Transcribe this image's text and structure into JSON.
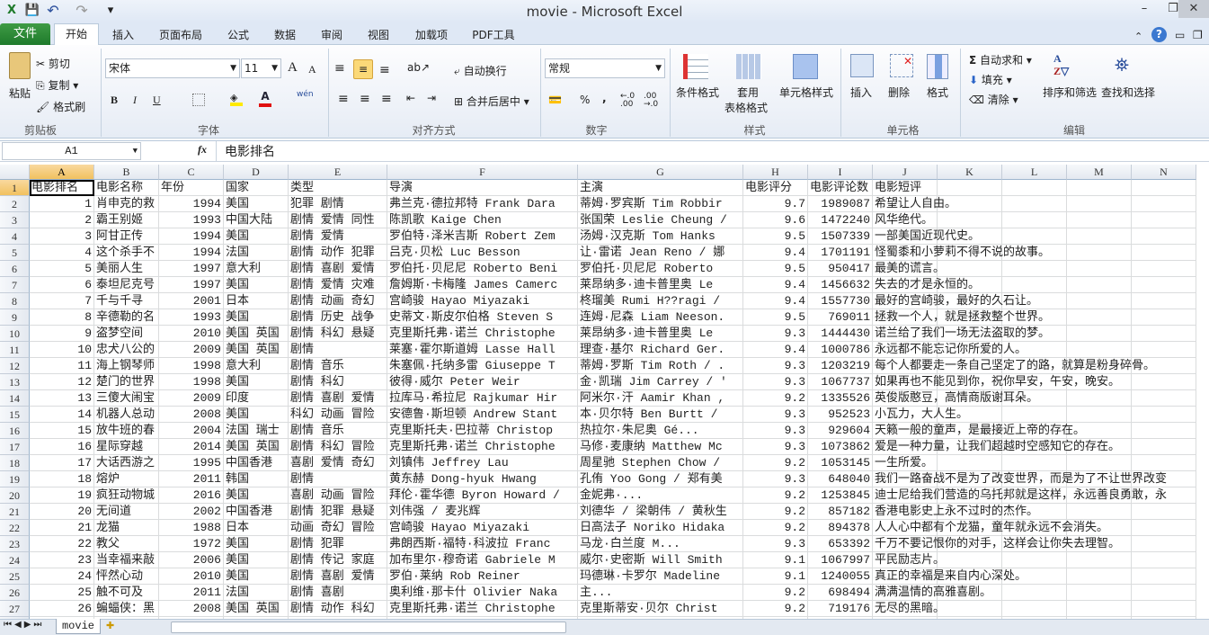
{
  "window": {
    "title": "movie - Microsoft Excel",
    "minimize": "–",
    "restore": "❐",
    "close": "✕"
  },
  "quick_access": {
    "save": "💾",
    "undo": "↶",
    "redo": "↷",
    "customize": "▾"
  },
  "tabs": [
    "文件",
    "开始",
    "插入",
    "页面布局",
    "公式",
    "数据",
    "审阅",
    "视图",
    "加载项",
    "PDF工具"
  ],
  "ribbon": {
    "clipboard": {
      "label": "剪贴板",
      "paste": "粘贴",
      "cut": "剪切",
      "copy": "复制",
      "format_painter": "格式刷"
    },
    "font": {
      "label": "字体",
      "font_name": "宋体",
      "font_size": "11",
      "bold": "B",
      "italic": "I",
      "underline": "U",
      "grow": "A",
      "shrink": "A",
      "phonetic": "wén"
    },
    "alignment": {
      "label": "对齐方式",
      "wrap": "自动换行",
      "merge": "合并后居中"
    },
    "number": {
      "label": "数字",
      "format": "常规",
      "percent": "%",
      "comma": ","
    },
    "styles": {
      "label": "样式",
      "conditional": "条件格式",
      "table_format_1": "套用",
      "table_format_2": "表格格式",
      "cell_styles": "单元格样式"
    },
    "cells": {
      "label": "单元格",
      "insert": "插入",
      "delete": "删除",
      "format": "格式"
    },
    "editing": {
      "label": "编辑",
      "autosum": "自动求和",
      "fill": "填充",
      "clear": "清除",
      "sort_filter": "排序和筛选",
      "find_select": "查找和选择"
    }
  },
  "formula_bar": {
    "name_box": "A1",
    "fx": "fx",
    "value": "电影排名"
  },
  "columns": [
    "A",
    "B",
    "C",
    "D",
    "E",
    "F",
    "G",
    "H",
    "I",
    "J",
    "K",
    "L",
    "M",
    "N"
  ],
  "header_row": [
    "电影排名",
    "电影名称",
    "年份",
    "国家",
    "类型",
    "导演",
    "主演",
    "电影评分",
    "电影评论数",
    "电影短评"
  ],
  "rows": [
    [
      "1",
      "肖申克的救",
      "1994",
      "美国",
      "犯罪 剧情",
      "弗兰克·德拉邦特 Frank Dara",
      "蒂姆·罗宾斯 Tim Robbir",
      "9.7",
      "1989087",
      "希望让人自由。"
    ],
    [
      "2",
      "霸王别姬",
      "1993",
      "中国大陆",
      "剧情 爱情 同性",
      "陈凯歌 Kaige Chen",
      "张国荣 Leslie Cheung /",
      "9.6",
      "1472240",
      "风华绝代。"
    ],
    [
      "3",
      "阿甘正传",
      "1994",
      "美国",
      "剧情 爱情",
      "罗伯特·泽米吉斯 Robert Zem",
      "汤姆·汉克斯 Tom Hanks",
      "9.5",
      "1507339",
      "一部美国近现代史。"
    ],
    [
      "4",
      "这个杀手不",
      "1994",
      "法国",
      "剧情 动作 犯罪",
      "吕克·贝松 Luc Besson",
      "让·雷诺 Jean Reno / 娜",
      "9.4",
      "1701191",
      "怪蜀黍和小萝莉不得不说的故事。"
    ],
    [
      "5",
      "美丽人生",
      "1997",
      "意大利",
      "剧情 喜剧 爱情",
      "罗伯托·贝尼尼 Roberto Beni",
      "罗伯托·贝尼尼 Roberto",
      "9.5",
      "950417",
      "最美的谎言。"
    ],
    [
      "6",
      "泰坦尼克号",
      "1997",
      "美国",
      "剧情 爱情 灾难",
      "詹姆斯·卡梅隆 James Camerc",
      "莱昂纳多·迪卡普里奥 Le",
      "9.4",
      "1456632",
      "失去的才是永恒的。"
    ],
    [
      "7",
      "千与千寻",
      "2001",
      "日本",
      "剧情 动画 奇幻",
      "宫崎骏 Hayao Miyazaki",
      "柊瑠美 Rumi H??ragi /",
      "9.4",
      "1557730",
      "最好的宫崎骏，最好的久石让。"
    ],
    [
      "8",
      "辛德勒的名",
      "1993",
      "美国",
      "剧情 历史 战争",
      "史蒂文·斯皮尔伯格 Steven S",
      "连姆·尼森 Liam Neeson.",
      "9.5",
      "769011",
      "拯救一个人，就是拯救整个世界。"
    ],
    [
      "9",
      "盗梦空间",
      "2010",
      "美国 英国",
      "剧情 科幻 悬疑",
      "克里斯托弗·诺兰 Christophe",
      "莱昂纳多·迪卡普里奥 Le",
      "9.3",
      "1444430",
      "诺兰给了我们一场无法盗取的梦。"
    ],
    [
      "10",
      "忠犬八公的",
      "2009",
      "美国 英国",
      "剧情",
      "莱塞·霍尔斯道姆 Lasse Hall",
      "理查·基尔 Richard Ger.",
      "9.4",
      "1000786",
      "永远都不能忘记你所爱的人。"
    ],
    [
      "11",
      "海上钢琴师",
      "1998",
      "意大利",
      "剧情 音乐",
      "朱塞佩·托纳多雷 Giuseppe T",
      "蒂姆·罗斯 Tim Roth / .",
      "9.3",
      "1203219",
      "每个人都要走一条自己坚定了的路，就算是粉身碎骨。"
    ],
    [
      "12",
      "楚门的世界",
      "1998",
      "美国",
      "剧情 科幻",
      "彼得·威尔 Peter Weir",
      "金·凯瑞 Jim Carrey / '",
      "9.3",
      "1067737",
      "如果再也不能见到你，祝你早安，午安，晚安。"
    ],
    [
      "13",
      "三傻大闹宝",
      "2009",
      "印度",
      "剧情 喜剧 爱情",
      "拉库马·希拉尼 Rajkumar Hir",
      "阿米尔·汗 Aamir Khan ,",
      "9.2",
      "1335526",
      "英俊版憨豆，高情商版谢耳朵。"
    ],
    [
      "14",
      "机器人总动",
      "2008",
      "美国",
      "科幻 动画 冒险",
      "安德鲁·斯坦顿 Andrew Stant",
      "本·贝尔特 Ben Burtt /",
      "9.3",
      "952523",
      "小瓦力，大人生。"
    ],
    [
      "15",
      "放牛班的春",
      "2004",
      "法国 瑞士",
      "剧情 音乐",
      "克里斯托夫·巴拉蒂 Christop",
      "热拉尔·朱尼奥 Gé...",
      "9.3",
      "929604",
      "天籁一般的童声，是最接近上帝的存在。"
    ],
    [
      "16",
      "星际穿越",
      "2014",
      "美国 英国",
      "剧情 科幻 冒险",
      "克里斯托弗·诺兰 Christophe",
      "马修·麦康纳 Matthew Mc",
      "9.3",
      "1073862",
      "爱是一种力量，让我们超越时空感知它的存在。"
    ],
    [
      "17",
      "大话西游之",
      "1995",
      "中国香港",
      "喜剧 爱情 奇幻",
      "刘镇伟 Jeffrey Lau",
      "周星驰 Stephen Chow /",
      "9.2",
      "1053145",
      "一生所爱。"
    ],
    [
      "18",
      "熔炉",
      "2011",
      "韩国",
      "剧情",
      "黄东赫 Dong-hyuk Hwang",
      "孔侑 Yoo Gong / 郑有美",
      "9.3",
      "648040",
      "我们一路奋战不是为了改变世界，而是为了不让世界改变"
    ],
    [
      "19",
      "疯狂动物城",
      "2016",
      "美国",
      "喜剧 动画 冒险",
      "拜伦·霍华德 Byron Howard /",
      "金妮弗·...",
      "9.2",
      "1253845",
      "迪士尼给我们营造的乌托邦就是这样，永远善良勇敢，永"
    ],
    [
      "20",
      "无间道",
      "2002",
      "中国香港",
      "剧情 犯罪 悬疑",
      "刘伟强 / 麦兆辉",
      "刘德华 / 梁朝伟 / 黄秋生",
      "9.2",
      "857182",
      "香港电影史上永不过时的杰作。"
    ],
    [
      "21",
      "龙猫",
      "1988",
      "日本",
      "动画 奇幻 冒险",
      "宫崎骏 Hayao Miyazaki",
      "日高法子 Noriko Hidaka",
      "9.2",
      "894378",
      "人人心中都有个龙猫，童年就永远不会消失。"
    ],
    [
      "22",
      "教父",
      "1972",
      "美国",
      "剧情 犯罪",
      "弗朗西斯·福特·科波拉 Franc",
      "马龙·白兰度 M...",
      "9.3",
      "653392",
      "千万不要记恨你的对手，这样会让你失去理智。"
    ],
    [
      "23",
      "当幸福来敲",
      "2006",
      "美国",
      "剧情 传记 家庭",
      "加布里尔·穆奇诺 Gabriele M",
      "威尔·史密斯 Will Smith",
      "9.1",
      "1067997",
      "平民励志片。"
    ],
    [
      "24",
      "怦然心动",
      "2010",
      "美国",
      "剧情 喜剧 爱情",
      "罗伯·莱纳 Rob Reiner",
      "玛德琳·卡罗尔 Madeline",
      "9.1",
      "1240055",
      "真正的幸福是来自内心深处。"
    ],
    [
      "25",
      "触不可及",
      "2011",
      "法国",
      "剧情 喜剧",
      "奥利维·那卡什 Olivier Naka",
      "主...",
      "9.2",
      "698494",
      "满满温情的高雅喜剧。"
    ],
    [
      "26",
      "蝙蝠侠：黑",
      "2008",
      "美国 英国",
      "剧情 动作 科幻",
      "克里斯托弗·诺兰 Christophe",
      "克里斯蒂安·贝尔 Christ",
      "9.2",
      "719176",
      "无尽的黑暗。"
    ]
  ],
  "sheet_tabs": {
    "active": "movie"
  },
  "colors": {
    "file_tab": "#2a8a37",
    "selected_header": "#f5cd7a",
    "gridline": "#dadcdd"
  }
}
